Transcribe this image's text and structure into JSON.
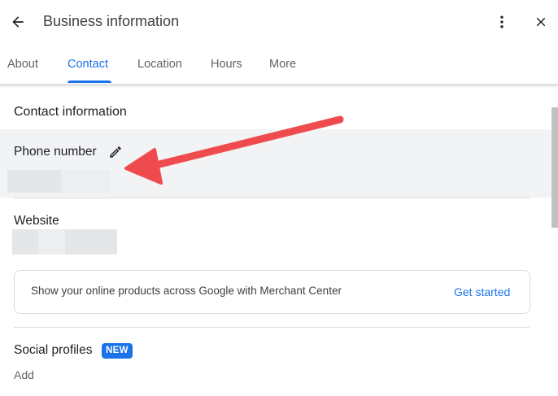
{
  "header": {
    "title": "Business information",
    "tabs": [
      {
        "label": "About"
      },
      {
        "label": "Contact"
      },
      {
        "label": "Location"
      },
      {
        "label": "Hours"
      },
      {
        "label": "More"
      }
    ],
    "active_tab": "Contact"
  },
  "contact": {
    "section_title": "Contact information",
    "phone_label": "Phone number",
    "website_label": "Website",
    "merchant_promo": "Show your online products across Google with Merchant Center",
    "get_started_label": "Get started",
    "social_label": "Social profiles",
    "new_badge": "NEW",
    "add_label": "Add"
  },
  "colors": {
    "accent": "#1a73e8",
    "annotation_arrow": "#ef4b4f",
    "highlight_row": "#f1f3f4"
  },
  "icons": [
    "arrow-left-icon",
    "more-vert-icon",
    "close-icon",
    "pencil-icon"
  ]
}
